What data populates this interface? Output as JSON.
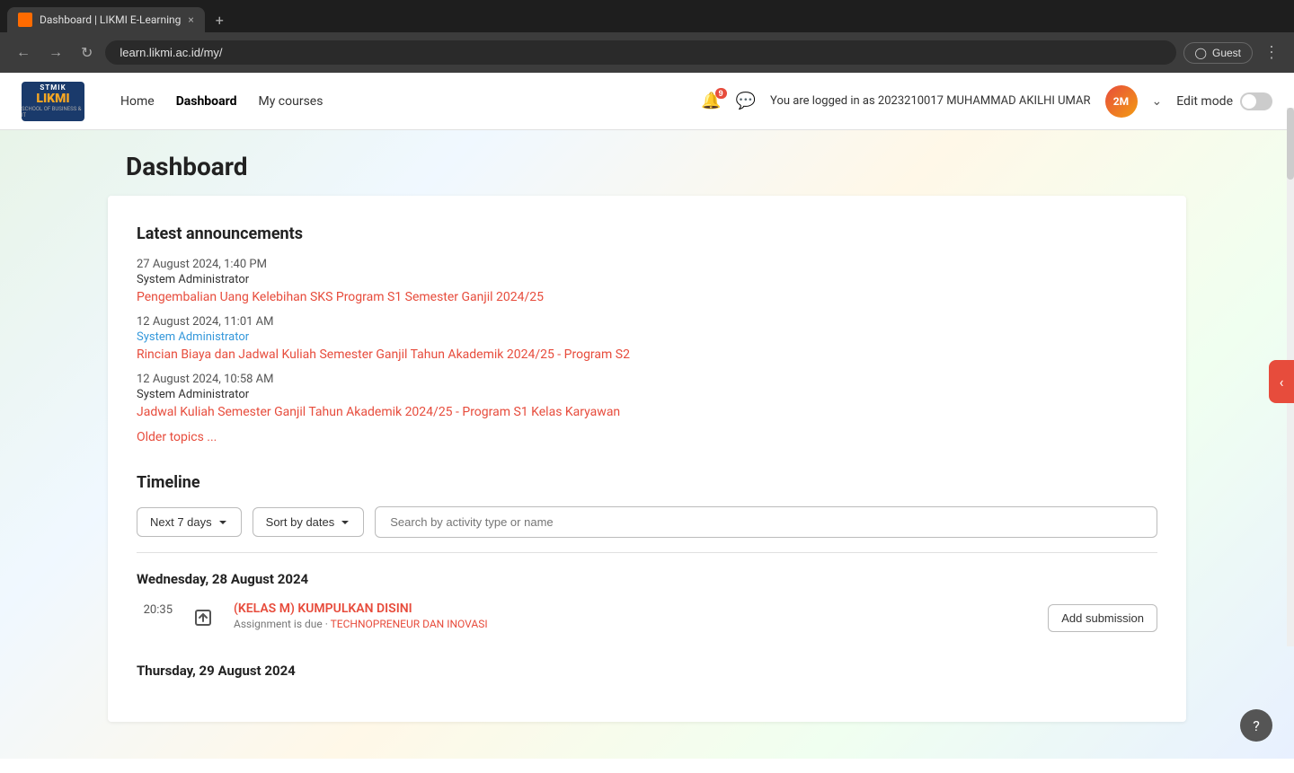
{
  "browser": {
    "tab_title": "Dashboard | LIKMI E-Learning",
    "url": "learn.likmi.ac.id/my/",
    "profile_label": "Guest",
    "new_tab_symbol": "+",
    "close_tab": "×"
  },
  "header": {
    "logo_stmik": "STMIK",
    "logo_likmi": "LIKMI",
    "logo_sub": "SCHOOL OF BUSINESS & IT",
    "nav": [
      {
        "label": "Home",
        "active": false
      },
      {
        "label": "Dashboard",
        "active": true
      },
      {
        "label": "My courses",
        "active": false
      }
    ],
    "notification_count": "9",
    "user_info": "You are logged in as 2023210017 MUHAMMAD AKILHI UMAR",
    "avatar_initials": "2M",
    "edit_mode_label": "Edit mode"
  },
  "page": {
    "title": "Dashboard"
  },
  "announcements": {
    "section_title": "Latest announcements",
    "items": [
      {
        "date": "27 August 2024, 1:40 PM",
        "author": "System Administrator",
        "link_text": "Pengembalian Uang Kelebihan SKS Program S1 Semester Ganjil 2024/25",
        "author_color": "default"
      },
      {
        "date": "12 August 2024, 11:01 AM",
        "author": "System Administrator",
        "link_text": "Rincian Biaya dan Jadwal Kuliah Semester Ganjil Tahun Akademik 2024/25 - Program S2",
        "author_color": "blue"
      },
      {
        "date": "12 August 2024, 10:58 AM",
        "author": "System Administrator",
        "link_text": "Jadwal Kuliah Semester Ganjil Tahun Akademik 2024/25 - Program S1 Kelas Karyawan",
        "author_color": "default"
      }
    ],
    "older_topics": "Older topics ..."
  },
  "timeline": {
    "section_title": "Timeline",
    "filter_label": "Next 7 days",
    "sort_label": "Sort by dates",
    "search_placeholder": "Search by activity type or name",
    "days": [
      {
        "day_label": "Wednesday, 28 August 2024",
        "entries": [
          {
            "time": "20:35",
            "title": "(KELAS M) KUMPULKAN DISINI",
            "subtitle": "Assignment is due · TECHNOPRENEUR DAN INOVASI",
            "action_label": "Add submission"
          }
        ]
      },
      {
        "day_label": "Thursday, 29 August 2024",
        "entries": []
      }
    ]
  },
  "sidebar_toggle": "‹",
  "help_label": "?"
}
